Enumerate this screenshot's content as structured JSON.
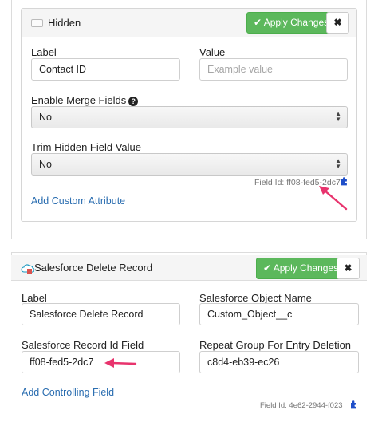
{
  "hidden_card": {
    "title": "Hidden",
    "apply_label": "Apply Changes",
    "close_label": "✖",
    "label_label": "Label",
    "label_value": "Contact ID",
    "value_label": "Value",
    "value_placeholder": "Example value",
    "merge_label": "Enable Merge Fields",
    "merge_value": "No",
    "trim_label": "Trim Hidden Field Value",
    "trim_value": "No",
    "field_id": "Field Id: ff08-fed5-2dc7",
    "add_attr": "Add Custom Attribute"
  },
  "sf_card": {
    "title": "Salesforce Delete Record",
    "apply_label": "Apply Changes",
    "close_label": "✖",
    "label_label": "Label",
    "label_value": "Salesforce Delete Record",
    "object_label": "Salesforce Object Name",
    "object_value": "Custom_Object__c",
    "record_label": "Salesforce Record Id Field",
    "record_value": "ff08-fed5-2dc7",
    "repeat_label": "Repeat Group For Entry Deletion",
    "repeat_value": "c8d4-eb39-ec26",
    "add_field": "Add Controlling Field",
    "field_id": "Field Id: 4e62-2944-f023"
  },
  "colors": {
    "apply_green": "#5cb85c",
    "link_blue": "#2a6db0",
    "arrow_pink": "#e8336d",
    "puzzle_blue": "#1f4fc9"
  }
}
